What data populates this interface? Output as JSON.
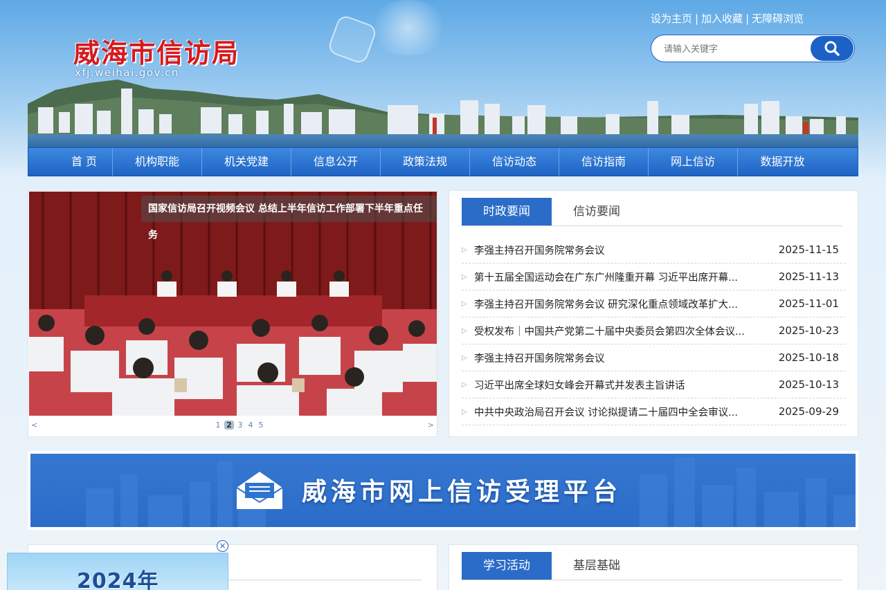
{
  "header": {
    "site_title": "威海市信访局",
    "domain": "xfj.weihai.gov.cn",
    "top_links": [
      "设为主页",
      "加入收藏",
      "无障碍浏览"
    ],
    "top_link_separator": "|",
    "search": {
      "placeholder": "请输入关键字",
      "icon": "search-icon"
    }
  },
  "nav": {
    "items": [
      "首 页",
      "机构职能",
      "机关党建",
      "信息公开",
      "政策法规",
      "信访动态",
      "信访指南",
      "网上信访",
      "数据开放"
    ]
  },
  "slider": {
    "caption": "国家信访局召开视频会议 总结上半年信访工作部署下半年重点任务",
    "prev": "<",
    "next": ">",
    "pages": [
      "1",
      "2",
      "3",
      "4",
      "5"
    ],
    "active_page": "2"
  },
  "news": {
    "tabs": [
      "时政要闻",
      "信访要闻"
    ],
    "active_tab": 0,
    "items": [
      {
        "title": "李强主持召开国务院常务会议",
        "date": "2025-11-15"
      },
      {
        "title": "第十五届全国运动会在广东广州隆重开幕 习近平出席开幕...",
        "date": "2025-11-13"
      },
      {
        "title": "李强主持召开国务院常务会议 研究深化重点领域改革扩大...",
        "date": "2025-11-01"
      },
      {
        "title": "受权发布｜中国共产党第二十届中央委员会第四次全体会议...",
        "date": "2025-10-23"
      },
      {
        "title": "李强主持召开国务院常务会议",
        "date": "2025-10-18"
      },
      {
        "title": "习近平出席全球妇女峰会开幕式并发表主旨讲话",
        "date": "2025-10-13"
      },
      {
        "title": "中共中央政治局召开会议 讨论拟提请二十届四中全会审议...",
        "date": "2025-09-29"
      }
    ]
  },
  "banner": {
    "text": "威海市网上信访受理平台",
    "icon": "envelope-icon"
  },
  "lower_right": {
    "tabs": [
      "学习活动",
      "基层基础"
    ]
  },
  "float_ad": {
    "text": "2024年",
    "close": "×"
  },
  "colors": {
    "nav_blue": "#2a6cc7",
    "title_red": "#d8191c",
    "banner_blue": "#2b6cc8"
  }
}
